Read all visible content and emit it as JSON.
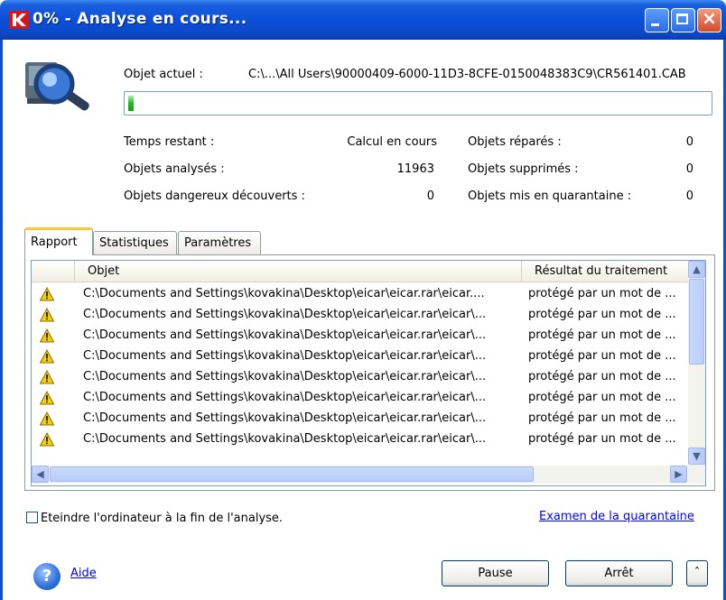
{
  "window": {
    "title": "0% - Analyse en cours..."
  },
  "status": {
    "current_object_label": "Objet actuel :",
    "current_object_value": "C:\\...\\All Users\\90000409-6000-11D3-8CFE-0150048383C9\\CR561401.CAB",
    "progress_fraction": 0.01,
    "time_remaining_label": "Temps restant :",
    "time_remaining_value": "Calcul en cours",
    "analyzed_label": "Objets analysés :",
    "analyzed_value": "11963",
    "dangerous_label": "Objets dangereux découverts :",
    "dangerous_value": "0",
    "repaired_label": "Objets réparés :",
    "repaired_value": "0",
    "deleted_label": "Objets supprimés :",
    "deleted_value": "0",
    "quarantined_label": "Objets mis en quarantaine :",
    "quarantined_value": "0"
  },
  "tabs": [
    "Rapport",
    "Statistiques",
    "Paramètres"
  ],
  "report": {
    "columns": [
      "Objet",
      "Résultat du traitement"
    ],
    "rows": [
      {
        "path": "C:\\Documents and Settings\\kovakina\\Desktop\\eicar\\eicar.rar\\eicar....",
        "result": "protégé par un mot de ..."
      },
      {
        "path": "C:\\Documents and Settings\\kovakina\\Desktop\\eicar\\eicar.rar\\eicar\\...",
        "result": "protégé par un mot de ..."
      },
      {
        "path": "C:\\Documents and Settings\\kovakina\\Desktop\\eicar\\eicar.rar\\eicar\\...",
        "result": "protégé par un mot de ..."
      },
      {
        "path": "C:\\Documents and Settings\\kovakina\\Desktop\\eicar\\eicar.rar\\eicar\\...",
        "result": "protégé par un mot de ..."
      },
      {
        "path": "C:\\Documents and Settings\\kovakina\\Desktop\\eicar\\eicar.rar\\eicar\\...",
        "result": "protégé par un mot de ..."
      },
      {
        "path": "C:\\Documents and Settings\\kovakina\\Desktop\\eicar\\eicar.rar\\eicar\\...",
        "result": "protégé par un mot de ..."
      },
      {
        "path": "C:\\Documents and Settings\\kovakina\\Desktop\\eicar\\eicar.rar\\eicar\\...",
        "result": "protégé par un mot de ..."
      },
      {
        "path": "C:\\Documents and Settings\\kovakina\\Desktop\\eicar\\eicar.rar\\eicar\\...",
        "result": "protégé par un mot de ..."
      }
    ]
  },
  "footer": {
    "shutdown_label": "Eteindre l'ordinateur à la fin de l'analyse.",
    "quarantine_link": "Examen de la quarantaine",
    "help_link": "Aide",
    "pause_button": "Pause",
    "stop_button": "Arrêt",
    "collapse_button": "ˆ"
  },
  "icons": {
    "app": "kaspersky-logo-icon",
    "scan": "magnifier-scan-icon",
    "warning": "warning-triangle-icon",
    "help": "help-icon"
  }
}
